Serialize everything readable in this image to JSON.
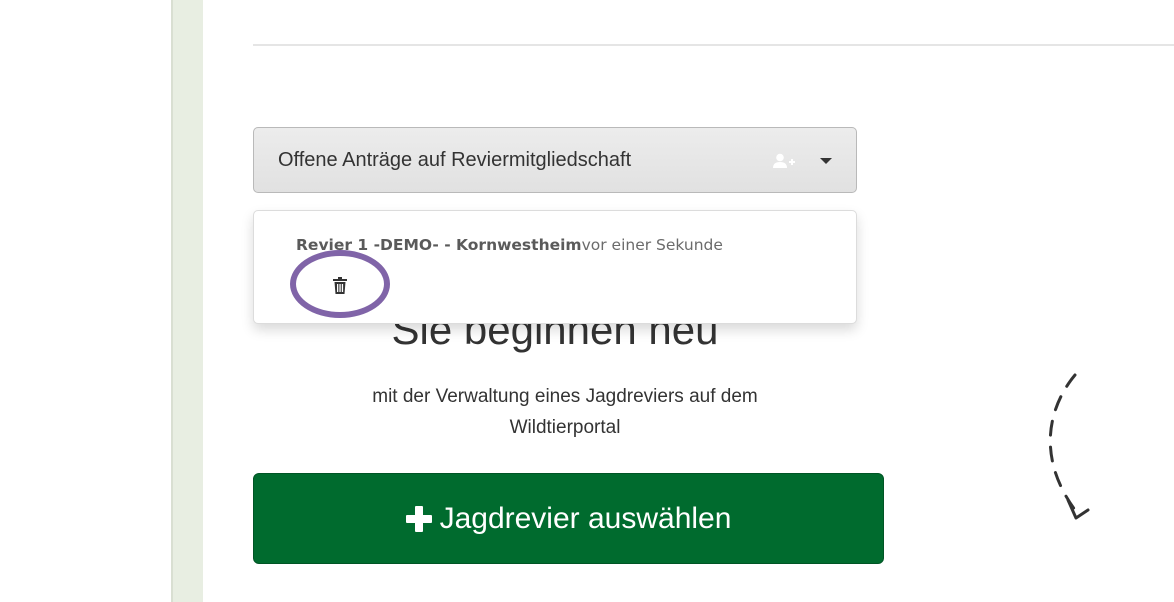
{
  "requests_dropdown": {
    "label": "Offene Anträge auf Reviermitgliedschaft",
    "icon": "user-plus-icon"
  },
  "request_item": {
    "revier_name": "Revier 1 -DEMO- - Kornwestheim",
    "time": "vor einer Sekunde",
    "delete_icon": "trash-icon"
  },
  "welcome": {
    "heading": "Sie beginnen neu",
    "line1": "mit der Verwaltung eines Jagdreviers auf dem",
    "line2": "Wildtierportal"
  },
  "select_button": {
    "label": "Jagdrevier auswählen"
  },
  "colors": {
    "primary_green": "#006b2e",
    "highlight_purple": "#8064a8",
    "sidebar_green": "#e8eee2"
  }
}
